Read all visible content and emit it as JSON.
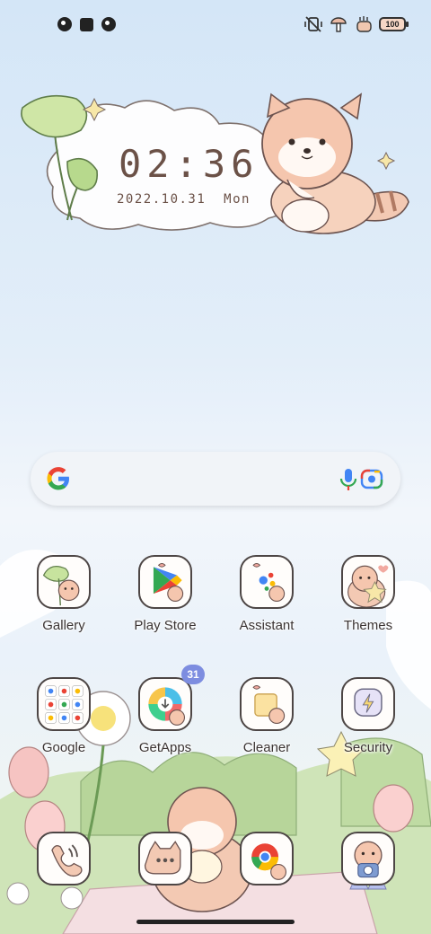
{
  "status_bar": {
    "left_icons": [
      "notification-icon",
      "square-notification-icon",
      "notification-icon"
    ],
    "right_icons": [
      "mute-vibrate-icon",
      "mushroom-icon",
      "hand-wave-icon"
    ],
    "battery": "100"
  },
  "clock_widget": {
    "time": "02:36",
    "date": "2022.10.31  Mon"
  },
  "search_bar": {
    "logo": "google-g-icon",
    "mic": "mic-icon",
    "lens": "lens-icon"
  },
  "apps": {
    "row1": [
      {
        "label": "Gallery"
      },
      {
        "label": "Play Store"
      },
      {
        "label": "Assistant"
      },
      {
        "label": "Themes"
      }
    ],
    "row2": [
      {
        "label": "Google"
      },
      {
        "label": "GetApps",
        "badge": "31"
      },
      {
        "label": "Cleaner"
      },
      {
        "label": "Security"
      }
    ],
    "dock": [
      {
        "icon": "phone-icon"
      },
      {
        "icon": "messages-icon"
      },
      {
        "icon": "chrome-icon"
      },
      {
        "icon": "camera-icon"
      }
    ]
  },
  "colors": {
    "accent": "#7d8de0",
    "brown_text": "#6b5147",
    "icon_border": "#4d4645"
  }
}
